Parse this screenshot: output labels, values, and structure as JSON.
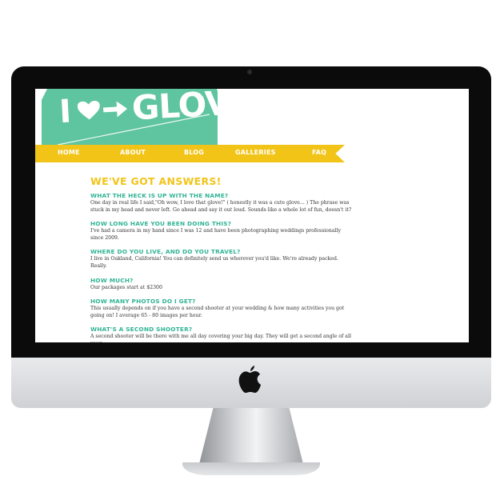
{
  "site": {
    "logo": {
      "prefix": "I",
      "word": "GLOVE",
      "color": "#5fc4a0"
    },
    "nav": [
      "HOME",
      "ABOUT",
      "BLOG",
      "GALLERIES",
      "FAQ"
    ],
    "colors": {
      "accent_yellow": "#f2c418",
      "accent_teal": "#2fb394"
    }
  },
  "faq": {
    "title": "WE'VE GOT ANSWERS!",
    "items": [
      {
        "q": "WHAT THE HECK IS UP WITH THE NAME?",
        "a": "One day in real life I said,\"Oh wow, I love that glove!\" ( honestly it was a cute glove... ) The phrase was stuck in my head and never left. Go ahead and say it out loud. Sounds like a whole lot of fun, doesn't it?"
      },
      {
        "q": "HOW LONG HAVE YOU BEEN DOING THIS?",
        "a": "I've had a camera in my hand since I was 12 and have been photographing weddings professionally since 2009."
      },
      {
        "q": "WHERE DO YOU LIVE, AND DO YOU TRAVEL?",
        "a": "I live in Oakland, California! You can definitely send us wherever you'd like. We're already packed. Really."
      },
      {
        "q": "HOW MUCH?",
        "a": "Our packages start at $2300"
      },
      {
        "q": "HOW MANY PHOTOS DO I GET?",
        "a": "This usually depends on if you have a second shooter at your wedding & how many activities you got going on! I average 65 - 80 images per hour."
      },
      {
        "q": "WHAT'S A SECOND SHOOTER?",
        "a": "A second shooter will be there with me all day covering your big day. They will get a second angle of all your"
      }
    ]
  }
}
